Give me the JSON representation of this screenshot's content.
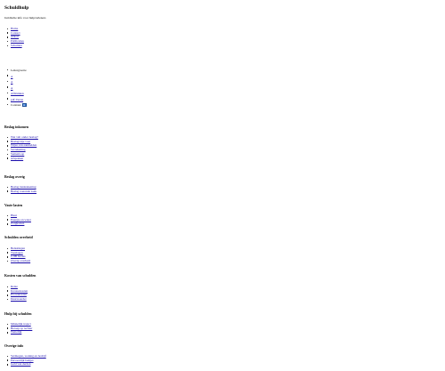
{
  "site": {
    "title": "Schuldhulp",
    "tagline": "Juridische info voor hulpverleners"
  },
  "main_nav": [
    "Home",
    "Contact",
    "Afkort",
    "Publicaties",
    "Schulden"
  ],
  "tools": {
    "text_size_label": "Lettergrootte",
    "size_small": "A",
    "size_medium": "A",
    "size_large": "A",
    "print_label": "Afdrukken",
    "pdf_label": "pdf-Versie",
    "contrast_label": "Contrast"
  },
  "sections": [
    {
      "heading": "Beslag inkomen",
      "links": [
        "Wat valt onder beslag?",
        "Beslagvrije voet",
        "Wijze van aanmelden",
        "Verrekening",
        "Samenloop",
        "Afspraken"
      ]
    },
    {
      "heading": "Beslag overig",
      "links": [
        "Beslag bankrekening",
        "Beslag roerende zaak"
      ]
    },
    {
      "heading": "Vaste lasten",
      "links": [
        "Huur",
        "Energie en water",
        "Zorgkosten"
      ]
    },
    {
      "heading": "Schulden overheid",
      "links": [
        "Belastingen",
        "Toeslagen",
        "CJIB boetes",
        "Overig overheid"
      ]
    },
    {
      "heading": "Kosten van schulden",
      "links": [
        "Rente",
        "Incassokosten",
        "Proceskosten",
        "Deurwaarder"
      ]
    },
    {
      "heading": "Hulp bij schulden",
      "links": [
        "Minnelijk traject",
        "Beroep op rechter",
        "Wettelijk"
      ]
    },
    {
      "heading": "Overige info",
      "links": [
        "Vermogen, woning en bedrijf",
        "Persoonlijk budget",
        "Geld van derden"
      ]
    }
  ]
}
